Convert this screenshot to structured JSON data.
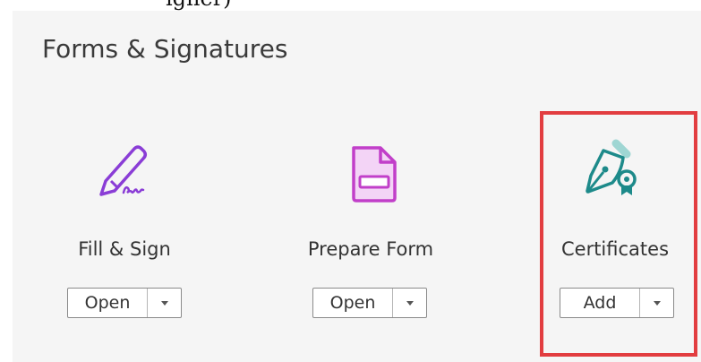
{
  "header_cutoff_text": "igner)",
  "section": {
    "title": "Forms & Signatures"
  },
  "tools": [
    {
      "label": "Fill & Sign",
      "button_label": "Open",
      "icon": "pen-sign-icon",
      "color": "#8a3dd6"
    },
    {
      "label": "Prepare Form",
      "button_label": "Open",
      "icon": "form-document-icon",
      "color": "#c13fc9"
    },
    {
      "label": "Certificates",
      "button_label": "Add",
      "icon": "certificate-pen-icon",
      "color": "#1d8a8a",
      "highlighted": true
    }
  ],
  "colors": {
    "panel_background": "#f5f5f5",
    "highlight_border": "#e23d40"
  }
}
